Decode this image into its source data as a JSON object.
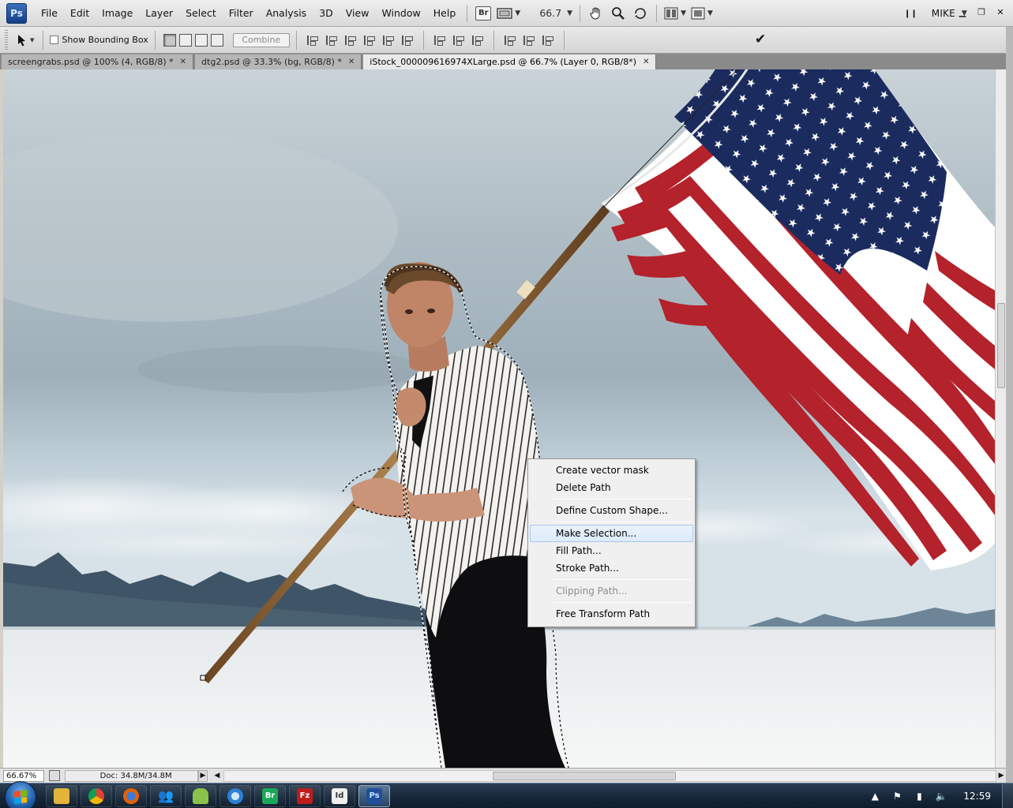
{
  "app": {
    "logo_text": "Ps",
    "menu": [
      "File",
      "Edit",
      "Image",
      "Layer",
      "Select",
      "Filter",
      "Analysis",
      "3D",
      "View",
      "Window",
      "Help"
    ],
    "bridge_label": "Br",
    "zoom_value": "66.7",
    "workspace_label": "MIKE"
  },
  "options_bar": {
    "show_bounding_box_label": "Show Bounding Box",
    "show_bounding_box_checked": false,
    "combine_label": "Combine"
  },
  "tabs": [
    {
      "label": "screengrabs.psd @ 100% (4, RGB/8) *",
      "active": false
    },
    {
      "label": "dtg2.psd @ 33.3% (bg, RGB/8) *",
      "active": false
    },
    {
      "label": "iStock_000009616974XLarge.psd @ 66.7% (Layer 0, RGB/8*)",
      "active": true
    }
  ],
  "context_menu": {
    "groups": [
      [
        "Create vector mask",
        "Delete Path"
      ],
      [
        "Define Custom Shape..."
      ],
      [
        "Make Selection...",
        "Fill Path...",
        "Stroke Path..."
      ],
      [
        "Clipping Path..."
      ],
      [
        "Free Transform Path"
      ]
    ],
    "highlighted_item": "Make Selection...",
    "disabled_items": [
      "Clipping Path..."
    ]
  },
  "status_bar": {
    "zoom": "66.67%",
    "doc_size": "Doc: 34.8M/34.8M"
  },
  "taskbar": {
    "apps": [
      "explorer-icon",
      "chrome-icon",
      "firefox-icon",
      "messenger-icon",
      "android-icon",
      "itunes-icon",
      "photoshop-bridge-icon",
      "filezilla-icon",
      "indesign-icon",
      "photoshop-icon"
    ],
    "clock": "12:59"
  },
  "colors": {
    "flag_red": "#b4222b",
    "flag_blue": "#1b2b5e",
    "menu_highlight": "#dcebfc",
    "taskbar": "#17283a"
  }
}
